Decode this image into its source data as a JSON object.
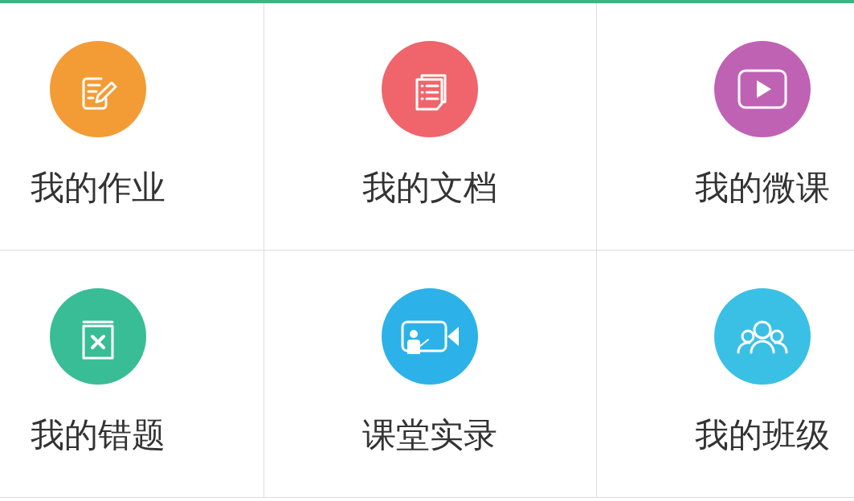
{
  "grid": [
    {
      "label": "我的作业",
      "color": "#f39c35",
      "kind": "homework"
    },
    {
      "label": "我的文档",
      "color": "#ef656b",
      "kind": "document"
    },
    {
      "label": "我的微课",
      "color": "#c062b4",
      "kind": "video"
    },
    {
      "label": "我的错题",
      "color": "#38bd96",
      "kind": "mistakes"
    },
    {
      "label": "课堂实录",
      "color": "#2cb2e8",
      "kind": "recording"
    },
    {
      "label": "我的班级",
      "color": "#3ac0e4",
      "kind": "class"
    }
  ]
}
